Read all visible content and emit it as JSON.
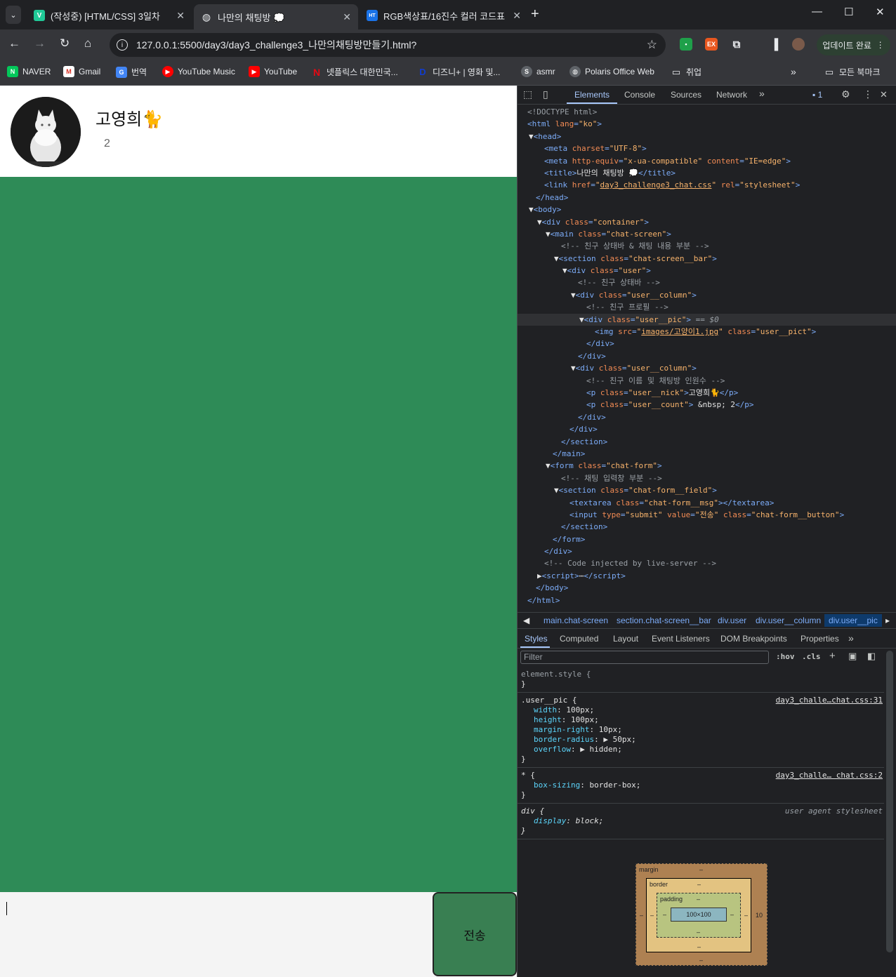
{
  "browser": {
    "tabs": [
      {
        "title": "(작성중) [HTML/CSS] 3일차",
        "icon": "V"
      },
      {
        "title": "나만의 채팅방 💭",
        "icon": "globe"
      },
      {
        "title": "RGB색상표/16진수 컬러 코드표",
        "icon": "HT"
      }
    ],
    "url": "127.0.0.1:5500/day3/day3_challenge3_나만의채팅방만들기.html?",
    "update_label": "업데이트 완료",
    "bookmarks": [
      "NAVER",
      "Gmail",
      "번역",
      "YouTube Music",
      "YouTube",
      "넷플릭스 대한민국...",
      "디즈니+ | 영화 및...",
      "asmr",
      "Polaris Office Web",
      "취업"
    ],
    "all_bookmarks": "모든 북마크"
  },
  "page": {
    "nick": "고영희🐈",
    "count": "2",
    "send_label": "전송",
    "colors": {
      "chat_bg": "#2e8b57",
      "button_bg": "#397f52"
    }
  },
  "devtools": {
    "tabs": [
      "Elements",
      "Console",
      "Sources",
      "Network"
    ],
    "issues": "1",
    "breadcrumbs": [
      "main.chat-screen",
      "section.chat-screen__bar",
      "div.user",
      "div.user__column",
      "div.user__pic"
    ],
    "style_tabs": [
      "Styles",
      "Computed",
      "Layout",
      "Event Listeners",
      "DOM Breakpoints",
      "Properties"
    ],
    "filter_placeholder": "Filter",
    "hov": ":hov",
    "cls": ".cls",
    "rules": {
      "element_style": "element.style {",
      "user_pic_selector": ".user__pic {",
      "user_pic_src": "day3_challe…chat.css:31",
      "universal_selector": "* {",
      "universal_src": "day3_challe… chat.css:2",
      "div_selector": "div {",
      "div_src": "user agent stylesheet",
      "props": [
        {
          "n": "width",
          "v": "100px;"
        },
        {
          "n": "height",
          "v": "100px;"
        },
        {
          "n": "margin-right",
          "v": "10px;"
        },
        {
          "n": "border-radius",
          "v": "▶ 50px;"
        },
        {
          "n": "overflow",
          "v": "▶ hidden;"
        }
      ],
      "box_sizing": {
        "n": "box-sizing",
        "v": "border-box;"
      },
      "display": {
        "n": "display",
        "v": "block;"
      }
    },
    "box_model": {
      "margin": "margin",
      "border": "border",
      "padding": "padding",
      "content": "100×100",
      "dash": "–",
      "margin_right": "10"
    }
  }
}
